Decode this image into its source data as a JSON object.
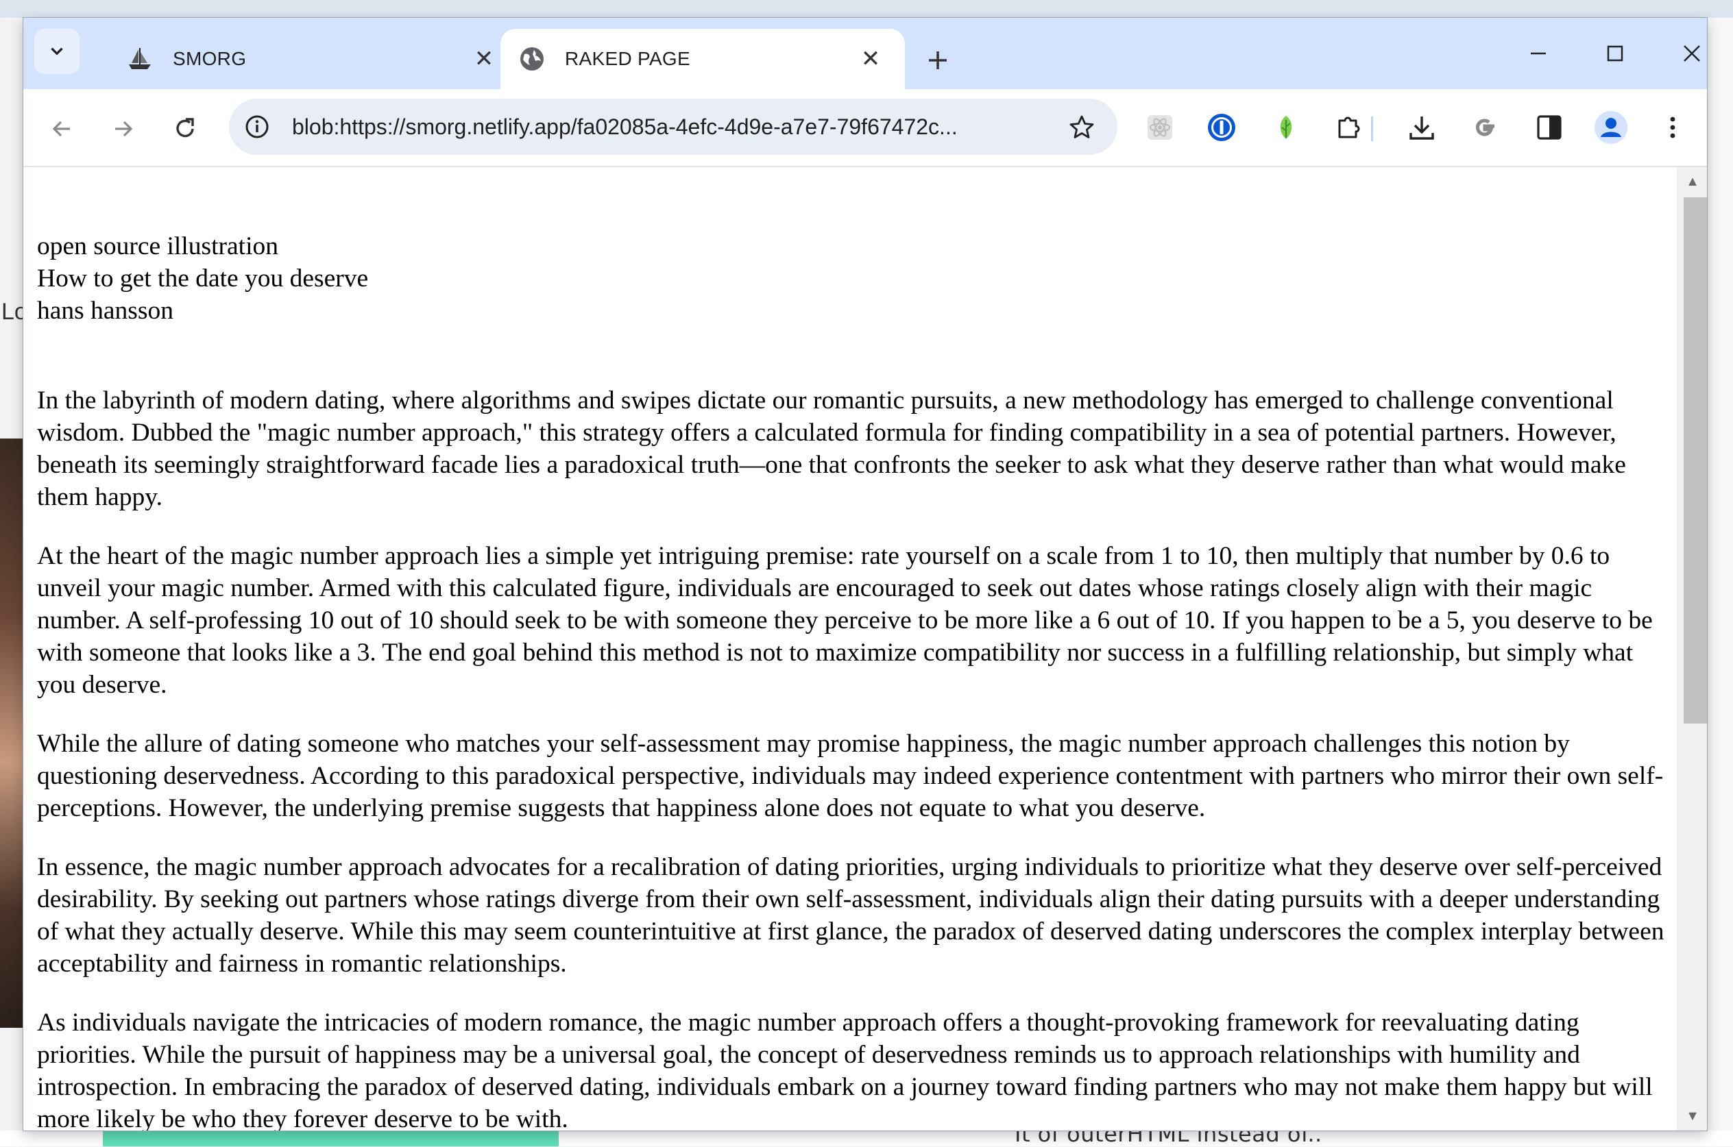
{
  "browser": {
    "tabs": [
      {
        "title": "SMORG",
        "icon": "ship-icon",
        "active": false
      },
      {
        "title": "RAKED PAGE",
        "icon": "globe-icon",
        "active": true
      }
    ],
    "address": "blob:https://smorg.netlify.app/fa02085a-4efc-4d9e-a7e7-79f67472c...",
    "extensions": [
      "react-devtools-icon",
      "password-manager-icon",
      "leaf-icon",
      "puzzle-icon"
    ],
    "toolbar_icons": [
      "download-icon",
      "google-icon",
      "side-panel-icon",
      "profile-icon",
      "menu-icon"
    ]
  },
  "page": {
    "header": [
      "open source illustration",
      "How to get the date you deserve",
      "hans hansson"
    ],
    "paragraphs": [
      "In the labyrinth of modern dating, where algorithms and swipes dictate our romantic pursuits, a new methodology has emerged to challenge conventional wisdom. Dubbed the \"magic number approach,\" this strategy offers a calculated formula for finding compatibility in a sea of potential partners. However, beneath its seemingly straightforward facade lies a paradoxical truth—one that confronts the seeker to ask what they deserve rather than what would make them happy.",
      "At the heart of the magic number approach lies a simple yet intriguing premise: rate yourself on a scale from 1 to 10, then multiply that number by 0.6 to unveil your magic number. Armed with this calculated figure, individuals are encouraged to seek out dates whose ratings closely align with their magic number. A self-professing 10 out of 10 should seek to be with someone they perceive to be more like a 6 out of 10. If you happen to be a 5, you deserve to be with someone that looks like a 3. The end goal behind this method is not to maximize compatibility nor success in a fulfilling relationship, but simply what you deserve.",
      "While the allure of dating someone who matches your self-assessment may promise happiness, the magic number approach challenges this notion by questioning deservedness. According to this paradoxical perspective, individuals may indeed experience contentment with partners who mirror their own self-perceptions. However, the underlying premise suggests that happiness alone does not equate to what you deserve.",
      "In essence, the magic number approach advocates for a recalibration of dating priorities, urging individuals to prioritize what they deserve over self-perceived desirability. By seeking out partners whose ratings diverge from their own self-assessment, individuals align their dating pursuits with a deeper understanding of what they actually deserve. While this may seem counterintuitive at first glance, the paradox of deserved dating underscores the complex interplay between acceptability and fairness in romantic relationships.",
      "As individuals navigate the intricacies of modern romance, the magic number approach offers a thought-provoking framework for reevaluating dating priorities. While the pursuit of happiness may be a universal goal, the concept of deservedness reminds us to approach relationships with humility and introspection. In embracing the paradox of deserved dating, individuals embark on a journey toward finding partners who may not make them happy but will more likely be who they forever deserve to be with."
    ]
  },
  "background": {
    "left_fragment": "Lo",
    "right_fragment": "It of outerHTML instead of.."
  },
  "colors": {
    "tabbar": "#d3e3fd",
    "omnibox": "#e9eef6",
    "profile": "#0b57d0"
  }
}
